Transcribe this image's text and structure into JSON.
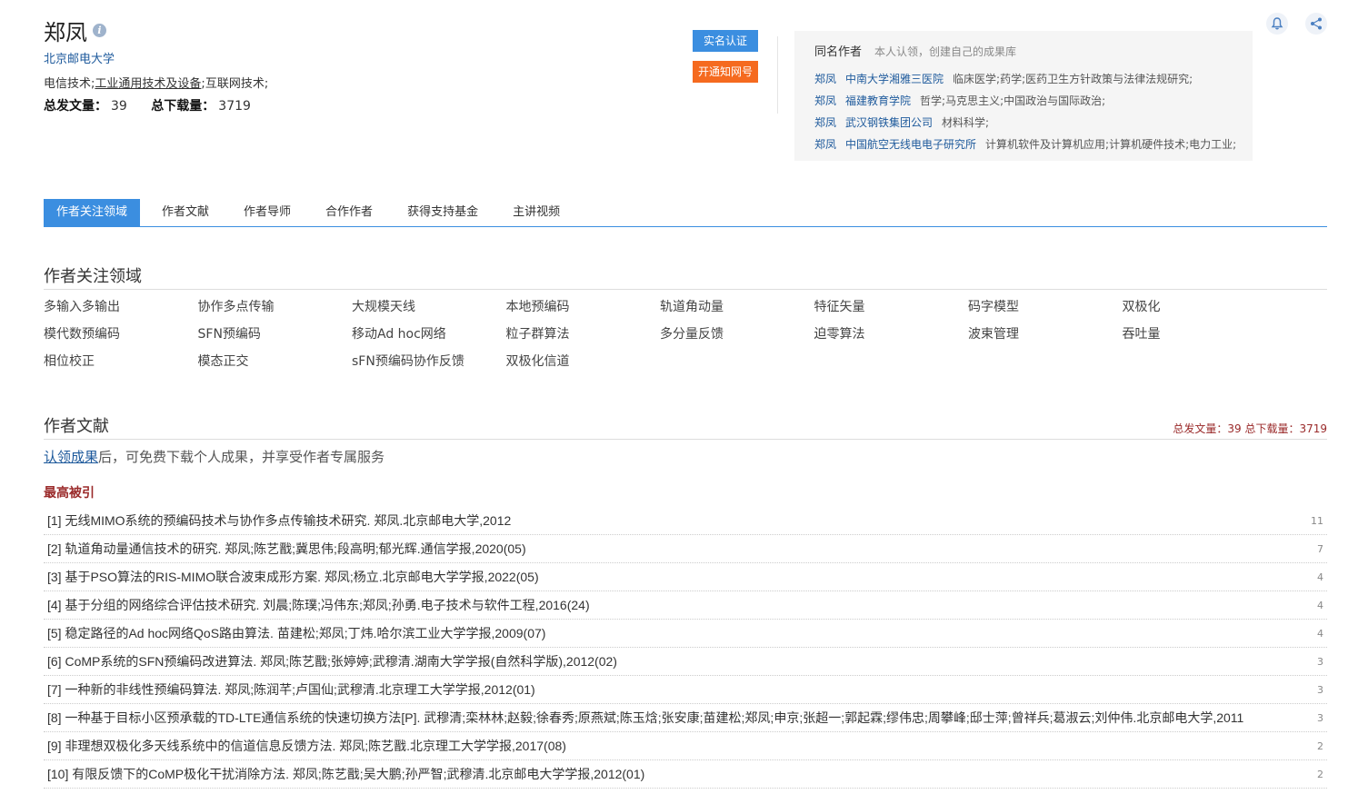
{
  "profile": {
    "name": "郑凤",
    "affiliation": "北京邮电大学",
    "fields": [
      "电信技术",
      "工业通用技术及设备",
      "互联网技术"
    ],
    "total_articles_label": "总发文量：",
    "total_articles": "39",
    "total_downloads_label": "总下载量：",
    "total_downloads": "3719"
  },
  "buttons": {
    "verify": "实名认证",
    "open": "开通知网号"
  },
  "same_name": {
    "title": "同名作者",
    "hint": "本人认领，创建自己的成果库",
    "items": [
      {
        "name": "郑凤",
        "org": "中南大学湘雅三医院",
        "fields": "临床医学;药学;医药卫生方针政策与法律法规研究;"
      },
      {
        "name": "郑凤",
        "org": "福建教育学院",
        "fields": "哲学;马克思主义;中国政治与国际政治;"
      },
      {
        "name": "郑凤",
        "org": "武汉钢铁集团公司",
        "fields": "材料科学;"
      },
      {
        "name": "郑凤",
        "org": "中国航空无线电电子研究所",
        "fields": "计算机软件及计算机应用;计算机硬件技术;电力工业;"
      }
    ]
  },
  "tabs": [
    "作者关注领域",
    "作者文献",
    "作者导师",
    "合作作者",
    "获得支持基金",
    "主讲视频"
  ],
  "focus": {
    "title": "作者关注领域",
    "keywords": [
      "多输入多输出",
      "协作多点传输",
      "大规模天线",
      "本地预编码",
      "轨道角动量",
      "特征矢量",
      "码字模型",
      "双极化",
      "模代数预编码",
      "SFN预编码",
      "移动Ad hoc网络",
      "粒子群算法",
      "多分量反馈",
      "迫零算法",
      "波束管理",
      "吞吐量",
      "相位校正",
      "模态正交",
      "sFN预编码协作反馈",
      "双极化信道"
    ]
  },
  "docs": {
    "title": "作者文献",
    "stats": "总发文量：39 总下载量：3719",
    "claim_link": "认领成果",
    "claim_rest": "后，可免费下载个人成果，并享受作者专属服务",
    "most_cited": "最高被引",
    "papers": [
      {
        "title": "[1] 无线MIMO系统的预编码技术与协作多点传输技术研究. 郑凤.北京邮电大学,2012",
        "count": "11"
      },
      {
        "title": "[2] 轨道角动量通信技术的研究. 郑凤;陈艺戬;冀思伟;段高明;郁光辉.通信学报,2020(05)",
        "count": "7"
      },
      {
        "title": "[3] 基于PSO算法的RIS-MIMO联合波束成形方案. 郑凤;杨立.北京邮电大学学报,2022(05)",
        "count": "4"
      },
      {
        "title": "[4] 基于分组的网络综合评估技术研究. 刘晨;陈璞;冯伟东;郑凤;孙勇.电子技术与软件工程,2016(24)",
        "count": "4"
      },
      {
        "title": "[5] 稳定路径的Ad hoc网络QoS路由算法. 苗建松;郑凤;丁炜.哈尔滨工业大学学报,2009(07)",
        "count": "4"
      },
      {
        "title": "[6] CoMP系统的SFN预编码改进算法. 郑凤;陈艺戬;张婷婷;武穆清.湖南大学学报(自然科学版),2012(02)",
        "count": "3"
      },
      {
        "title": "[7] 一种新的非线性预编码算法. 郑凤;陈润芊;卢国仙;武穆清.北京理工大学学报,2012(01)",
        "count": "3"
      },
      {
        "title": "[8] 一种基于目标小区预承载的TD-LTE通信系统的快速切换方法[P]. 武穆清;栾林林;赵毅;徐春秀;原燕斌;陈玉焓;张安康;苗建松;郑凤;申京;张超一;郭起霖;缪伟忠;周攀峰;邸士萍;曾祥兵;葛淑云;刘仲伟.北京邮电大学,2011",
        "count": "3"
      },
      {
        "title": "[9] 非理想双极化多天线系统中的信道信息反馈方法. 郑凤;陈艺戬.北京理工大学学报,2017(08)",
        "count": "2"
      },
      {
        "title": "[10] 有限反馈下的CoMP极化干扰消除方法. 郑凤;陈艺戬;吴大鹏;孙严智;武穆清.北京邮电大学学报,2012(01)",
        "count": "2"
      }
    ]
  }
}
